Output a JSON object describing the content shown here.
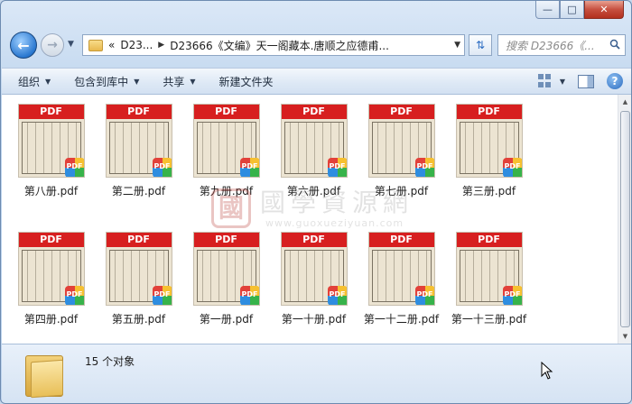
{
  "window": {
    "caption": {
      "minimize": "—",
      "maximize": "□",
      "close": "✕"
    }
  },
  "nav": {
    "back_icon": "back-arrow-icon",
    "forward_icon": "forward-arrow-icon",
    "breadcrumb": [
      {
        "label": "«"
      },
      {
        "label": "D23..."
      },
      {
        "label": "D23666《文编》天一阁藏本.唐顺之应德甫..."
      }
    ],
    "search_placeholder": "搜索 D23666《..."
  },
  "toolbar": {
    "organize": "组织",
    "include_in_library": "包含到库中",
    "share": "共享",
    "new_folder": "新建文件夹"
  },
  "files": [
    {
      "name": "第八册.pdf",
      "band": "PDF",
      "badge": "PDF"
    },
    {
      "name": "第二册.pdf",
      "band": "PDF",
      "badge": "PDF"
    },
    {
      "name": "第九册.pdf",
      "band": "PDF",
      "badge": "PDF"
    },
    {
      "name": "第六册.pdf",
      "band": "PDF",
      "badge": "PDF"
    },
    {
      "name": "第七册.pdf",
      "band": "PDF",
      "badge": "PDF"
    },
    {
      "name": "第三册.pdf",
      "band": "PDF",
      "badge": "PDF"
    },
    {
      "name": "第四册.pdf",
      "band": "PDF",
      "badge": "PDF"
    },
    {
      "name": "第五册.pdf",
      "band": "PDF",
      "badge": "PDF"
    },
    {
      "name": "第一册.pdf",
      "band": "PDF",
      "badge": "PDF"
    },
    {
      "name": "第一十册.pdf",
      "band": "PDF",
      "badge": "PDF"
    },
    {
      "name": "第一十二册.pdf",
      "band": "PDF",
      "badge": "PDF"
    },
    {
      "name": "第一十三册.pdf",
      "band": "PDF",
      "badge": "PDF"
    }
  ],
  "watermark": {
    "seal_char": "國",
    "title": "國學資源網",
    "url": "www.guoxueziyuan.com"
  },
  "details": {
    "count_text": "15 个对象"
  }
}
